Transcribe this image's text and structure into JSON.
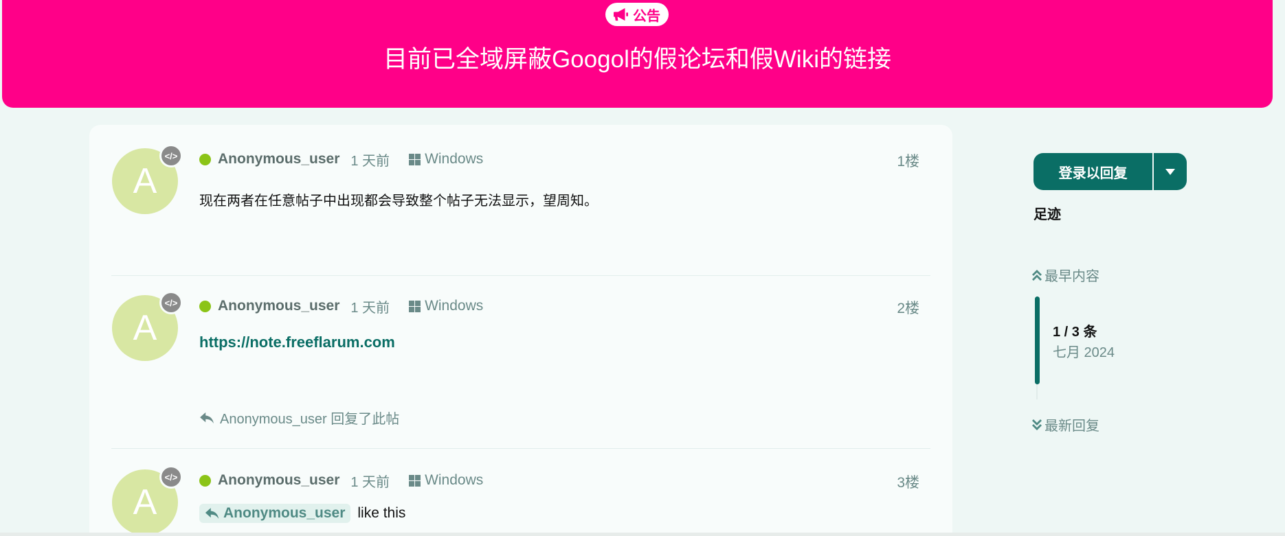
{
  "hero": {
    "badge_label": "公告",
    "badge_icon": "bullhorn-icon",
    "title": "目前已全域屏蔽Googol的假论坛和假Wiki的链接",
    "background_color": "#ff0088"
  },
  "posts": [
    {
      "avatar_letter": "A",
      "author": "Anonymous_user",
      "time": "1 天前",
      "os": "Windows",
      "floor": "1楼",
      "body": "现在两者在任意帖子中出现都会导致整个帖子无法显示，望周知。"
    },
    {
      "avatar_letter": "A",
      "author": "Anonymous_user",
      "time": "1 天前",
      "os": "Windows",
      "floor": "2楼",
      "link": "https://note.freeflarum.com",
      "replied_by": "Anonymous_user 回复了此帖"
    },
    {
      "avatar_letter": "A",
      "author": "Anonymous_user",
      "time": "1 天前",
      "os": "Windows",
      "floor": "3楼",
      "mention": "Anonymous_user",
      "body": "like this"
    }
  ],
  "sidebar": {
    "reply_button": "登录以回复",
    "footprint": "足迹",
    "scrubber": {
      "first_label": "最早内容",
      "count": "1 / 3 条",
      "date": "七月 2024",
      "last_label": "最新回复"
    }
  },
  "colors": {
    "accent": "#0a6e65",
    "hero": "#ff0088",
    "avatar": "#d8e7a3",
    "online": "#8bc417"
  }
}
